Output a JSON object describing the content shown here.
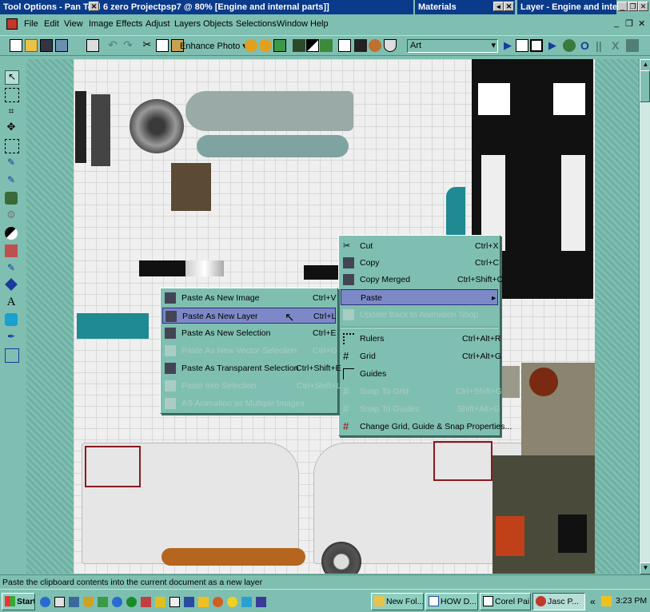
{
  "title_bars": {
    "tool_options": "Tool Options - Pan Tool",
    "document": "6 zero Projectpsp7 @  80% [Engine and internal parts]]",
    "materials": "Materials",
    "layer": "Layer - Engine and intern"
  },
  "menubar": [
    "File",
    "Edit",
    "View",
    "Image",
    "Effects",
    "Adjust",
    "Layers",
    "Objects",
    "Selections",
    "Window",
    "Help"
  ],
  "toolbar": {
    "enhance_photo": "Enhance Photo",
    "preset_value": "Art"
  },
  "paste_submenu": {
    "items": [
      {
        "label": "Paste As New Image",
        "shortcut": "Ctrl+V",
        "enabled": true
      },
      {
        "label": "Paste As New Layer",
        "shortcut": "Ctrl+L",
        "enabled": true,
        "selected": true
      },
      {
        "label": "Paste As New Selection",
        "shortcut": "Ctrl+E",
        "enabled": true
      },
      {
        "label": "Paste As New Vector Selection",
        "shortcut": "Ctrl+G",
        "enabled": false
      },
      {
        "label": "Paste As Transparent Selection",
        "shortcut": "Ctrl+Shift+E",
        "enabled": true
      },
      {
        "label": "Paste Into Selection",
        "shortcut": "Ctrl+Shift+L",
        "enabled": false
      },
      {
        "label": "AS Animation as Multiple Images",
        "shortcut": "",
        "enabled": false
      }
    ]
  },
  "context_menu": {
    "items": [
      {
        "label": "Cut",
        "shortcut": "Ctrl+X",
        "enabled": true
      },
      {
        "label": "Copy",
        "shortcut": "Ctrl+C",
        "enabled": true
      },
      {
        "label": "Copy Merged",
        "shortcut": "Ctrl+Shift+C",
        "enabled": true
      },
      {
        "label": "Paste",
        "shortcut": "",
        "enabled": true,
        "selected": true
      },
      {
        "label": "Update Back to Animation Shop",
        "shortcut": "",
        "enabled": false
      },
      {
        "label": "Rulers",
        "shortcut": "Ctrl+Alt+R",
        "enabled": true
      },
      {
        "label": "Grid",
        "shortcut": "Ctrl+Alt+G",
        "enabled": true
      },
      {
        "label": "Guides",
        "shortcut": "",
        "enabled": true
      },
      {
        "label": "Snap To Grid",
        "shortcut": "Ctrl+Shift+G",
        "enabled": false
      },
      {
        "label": "Snap To Guides",
        "shortcut": "Shift+Alt+G",
        "enabled": false
      },
      {
        "label": "Change Grid, Guide & Snap Properties...",
        "shortcut": "",
        "enabled": true
      }
    ]
  },
  "status_text": "Paste the clipboard contents into the current document as a new layer",
  "taskbar": {
    "start": "Start",
    "tasks": [
      "New Fol...",
      "HOW D...",
      "Corel Pai...",
      "Jasc P..."
    ],
    "clock": "3:23 PM"
  },
  "colors": {
    "accent": "#7fbfb1",
    "selection": "#7d89c7",
    "titlebar": "#0a3a8a"
  }
}
